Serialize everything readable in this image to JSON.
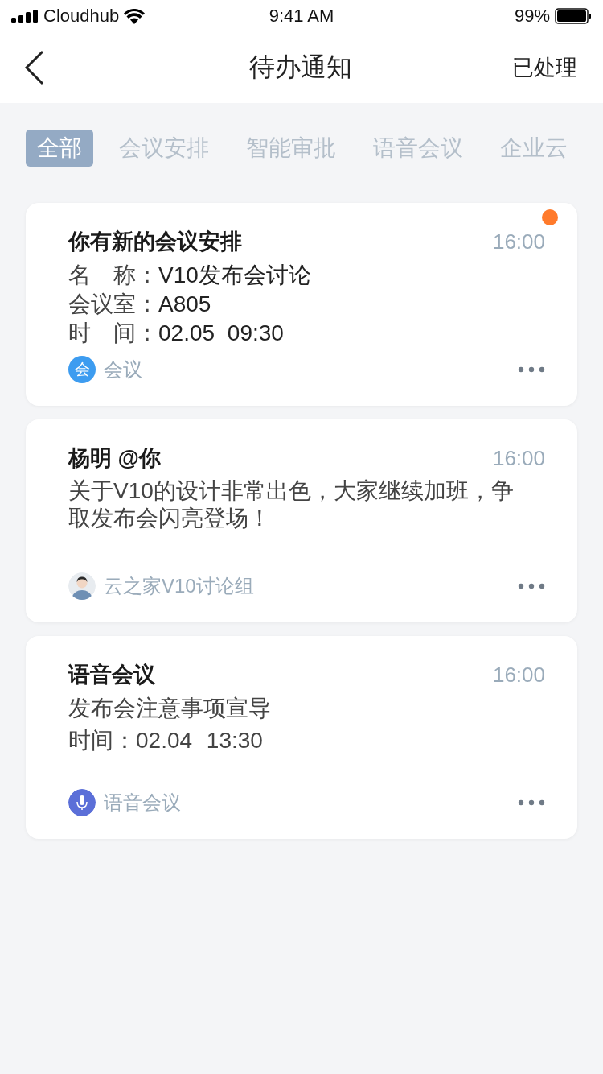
{
  "status_bar": {
    "carrier": "Cloudhub",
    "time": "9:41 AM",
    "battery": "99%"
  },
  "nav": {
    "title": "待办通知",
    "action": "已处理"
  },
  "tabs": [
    {
      "label": "全部",
      "selected": true
    },
    {
      "label": "会议安排",
      "selected": false
    },
    {
      "label": "智能审批",
      "selected": false
    },
    {
      "label": "语音会议",
      "selected": false
    },
    {
      "label": "企业云",
      "selected": false
    }
  ],
  "cards": [
    {
      "title": "你有新的会议安排",
      "time": "16:00",
      "unread": true,
      "kind": "fields",
      "lines": [
        {
          "label": "名　称：",
          "value": "V10发布会讨论"
        },
        {
          "label": "会议室：",
          "value": "A805"
        },
        {
          "label": "时　间：",
          "value": "02.05 09:30"
        }
      ],
      "source": {
        "kind": "letter",
        "letter": "会",
        "label": "会议"
      }
    },
    {
      "title": "杨明 @你",
      "time": "16:00",
      "unread": false,
      "kind": "paragraph",
      "text": "关于V10的设计非常出色，大家继续加班，争取发布会闪亮登场！",
      "source": {
        "kind": "avatar",
        "label": "云之家V10讨论组"
      }
    },
    {
      "title": "语音会议",
      "time": "16:00",
      "unread": false,
      "kind": "plain",
      "lines": [
        "发布会注意事项宣导",
        "时间：02.04 13:30"
      ],
      "source": {
        "kind": "mic",
        "label": "语音会议"
      }
    }
  ]
}
